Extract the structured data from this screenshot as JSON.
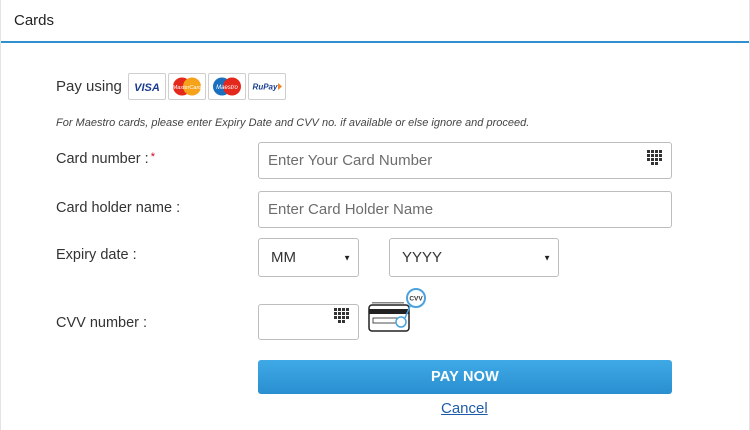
{
  "header": {
    "title": "Cards"
  },
  "pay_using": {
    "label": "Pay using",
    "logos": [
      {
        "name": "visa-logo",
        "text": "VISA",
        "color": "#1a3c8f"
      },
      {
        "name": "mastercard-logo",
        "text": "MasterCard",
        "color": "#e4281b"
      },
      {
        "name": "maestro-logo",
        "text": "Maestro",
        "color": "#1a6fbf"
      },
      {
        "name": "rupay-logo",
        "text": "RuPay",
        "color": "#1b3f8f"
      }
    ]
  },
  "note": "For Maestro cards, please enter Expiry Date and CVV no. if available or else ignore and proceed.",
  "form": {
    "card_number": {
      "label": "Card number :",
      "required_mark": "*",
      "placeholder": "Enter Your Card Number",
      "value": ""
    },
    "holder_name": {
      "label": "Card holder name :",
      "placeholder": "Enter Card Holder Name",
      "value": ""
    },
    "expiry": {
      "label": "Expiry date :",
      "month": "MM",
      "year": "YYYY"
    },
    "cvv": {
      "label": "CVV number :",
      "value": "",
      "badge": "CVV"
    }
  },
  "actions": {
    "pay_now": "PAY NOW",
    "cancel": "Cancel"
  },
  "colors": {
    "accent": "#2f8fcf",
    "button": "#2f9bdc",
    "link": "#1f5ca8",
    "required": "#d0021b"
  }
}
